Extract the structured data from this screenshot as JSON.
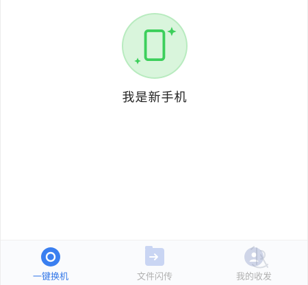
{
  "hero": {
    "label": "我是新手机",
    "icon": "phone-icon",
    "accent": "#3ccf5b"
  },
  "tabbar": {
    "active_color": "#3478e8",
    "inactive_color": "#b0b0b0",
    "tabs": [
      {
        "label": "一键换机",
        "icon": "switch-icon",
        "active": true
      },
      {
        "label": "文件闪传",
        "icon": "folder-transfer-icon",
        "active": false
      },
      {
        "label": "我的收发",
        "icon": "person-icon",
        "active": false
      }
    ]
  }
}
